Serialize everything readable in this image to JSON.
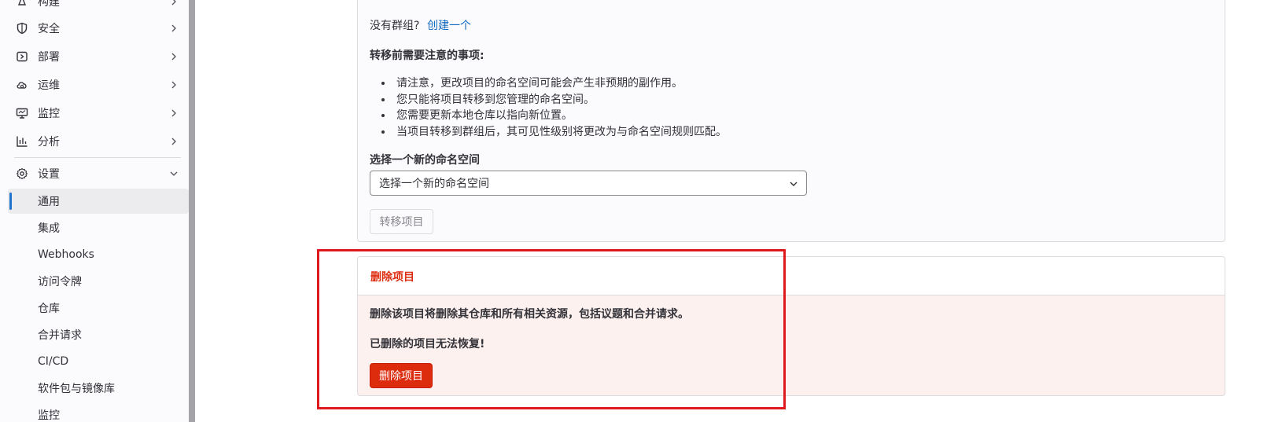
{
  "sidebar": {
    "items": [
      {
        "label": "构建",
        "icon": "rocket-icon"
      },
      {
        "label": "安全",
        "icon": "shield-icon"
      },
      {
        "label": "部署",
        "icon": "deploy-icon"
      },
      {
        "label": "运维",
        "icon": "cloud-gear-icon"
      },
      {
        "label": "监控",
        "icon": "monitor-icon"
      },
      {
        "label": "分析",
        "icon": "chart-icon"
      },
      {
        "label": "设置",
        "icon": "gear-icon"
      }
    ],
    "settings_subitems": [
      {
        "label": "通用",
        "active": true
      },
      {
        "label": "集成"
      },
      {
        "label": "Webhooks"
      },
      {
        "label": "访问令牌"
      },
      {
        "label": "仓库"
      },
      {
        "label": "合并请求"
      },
      {
        "label": "CI/CD"
      },
      {
        "label": "软件包与镜像库"
      },
      {
        "label": "监控"
      }
    ]
  },
  "transfer": {
    "no_group_text": "没有群组?",
    "create_link": "创建一个",
    "notes_title": "转移前需要注意的事项:",
    "notes": [
      "请注意，更改项目的命名空间可能会产生非预期的副作用。",
      "您只能将项目转移到您管理的命名空间。",
      "您需要更新本地仓库以指向新位置。",
      "当项目转移到群组后，其可见性级别将更改为与命名空间规则匹配。"
    ],
    "namespace_label": "选择一个新的命名空间",
    "namespace_select_value": "选择一个新的命名空间",
    "transfer_button": "转移项目"
  },
  "delete": {
    "title": "删除项目",
    "warning": "删除该项目将删除其仓库和所有相关资源，包括议题和合并请求。",
    "irreversible": "已删除的项目无法恢复!",
    "delete_button": "删除项目"
  },
  "colors": {
    "danger": "#dd2b0e",
    "highlight": "#e0191f",
    "link": "#1068bf",
    "active_indicator": "#1f75cb"
  }
}
